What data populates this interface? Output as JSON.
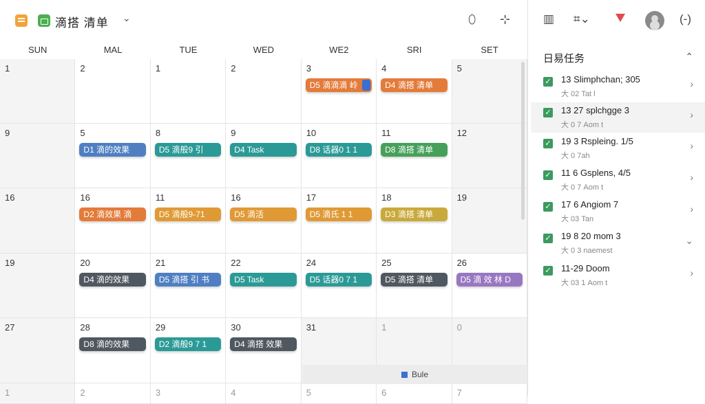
{
  "header": {
    "title": "滴搭 清单",
    "chevron_icon": "chevron-down-icon",
    "icons": [
      "shield-icon",
      "adjust-icon"
    ]
  },
  "weekdays": [
    "SUN",
    "MAL",
    "TUE",
    "WED",
    "WE2",
    "SRI",
    "SET"
  ],
  "colors": {
    "orange": "#e37b3a",
    "blue": "#4f7fc2",
    "teal": "#2b9a96",
    "green": "#46a05a",
    "amber": "#e09a35",
    "olive": "#c9a93b",
    "slate": "#4f5761",
    "purple": "#9877c2",
    "checkbox": "#3c9a5f",
    "accent_blue": "#3b6fd1"
  },
  "weeks": [
    [
      {
        "day": "1",
        "grey": true
      },
      {
        "day": "2"
      },
      {
        "day": "1"
      },
      {
        "day": "2"
      },
      {
        "day": "3",
        "event": {
          "label": "D5 滴滴滴 岭",
          "color": "orange"
        }
      },
      {
        "day": "4",
        "event": {
          "label": "D4 滴搭 清单",
          "color": "orange"
        }
      },
      {
        "day": "5",
        "grey": true
      }
    ],
    [
      {
        "day": "9",
        "grey": true
      },
      {
        "day": "5",
        "event": {
          "label": "D1 滴的效果",
          "color": "blue"
        }
      },
      {
        "day": "8",
        "event": {
          "label": "D5 滴般9 引",
          "color": "teal"
        }
      },
      {
        "day": "9",
        "event": {
          "label": "D4 Task",
          "color": "teal"
        }
      },
      {
        "day": "10",
        "event": {
          "label": "D8 话器0 1 1",
          "color": "teal"
        }
      },
      {
        "day": "11",
        "event": {
          "label": "D8 滴搭 清单",
          "color": "green"
        }
      },
      {
        "day": "12",
        "grey": true
      }
    ],
    [
      {
        "day": "16",
        "grey": true
      },
      {
        "day": "16",
        "event": {
          "label": "D2 滴效果 滴",
          "color": "orange"
        }
      },
      {
        "day": "11",
        "event": {
          "label": "D5 滴般9-71",
          "color": "amber"
        }
      },
      {
        "day": "16",
        "event": {
          "label": "D5 滴活",
          "color": "amber"
        }
      },
      {
        "day": "17",
        "event": {
          "label": "D5 滴氏 1 1",
          "color": "amber"
        }
      },
      {
        "day": "18",
        "event": {
          "label": "D3 滴搭 清单",
          "color": "olive"
        }
      },
      {
        "day": "19",
        "grey": true
      }
    ],
    [
      {
        "day": "19",
        "grey": true
      },
      {
        "day": "20",
        "event": {
          "label": "D4 滴的效果",
          "color": "slate"
        }
      },
      {
        "day": "21",
        "event": {
          "label": "D5 滴搭 引 书",
          "color": "blue"
        }
      },
      {
        "day": "22",
        "event": {
          "label": "D5 Task",
          "color": "teal"
        }
      },
      {
        "day": "24",
        "event": {
          "label": "D5 话器0 7 1",
          "color": "teal"
        }
      },
      {
        "day": "25",
        "event": {
          "label": "D5 滴搭 清单",
          "color": "slate"
        }
      },
      {
        "day": "26",
        "event": {
          "label": "D5 滴 效 林 D",
          "color": "purple"
        }
      }
    ],
    [
      {
        "day": "27",
        "grey": true
      },
      {
        "day": "28",
        "event": {
          "label": "D8 滴的效果",
          "color": "slate"
        }
      },
      {
        "day": "29",
        "event": {
          "label": "D2 滴般9 7 1",
          "color": "teal"
        }
      },
      {
        "day": "30",
        "event": {
          "label": "D4 滴搭 效果",
          "color": "slate"
        }
      },
      {
        "day": "31",
        "grey": true
      },
      {
        "day": "1",
        "grey": true,
        "muted": true
      },
      {
        "day": "0",
        "grey": true,
        "muted": true
      }
    ],
    [
      {
        "day": "1",
        "grey": true,
        "muted": true
      },
      {
        "day": "2",
        "muted": true
      },
      {
        "day": "3",
        "muted": true
      },
      {
        "day": "4",
        "muted": true
      },
      {
        "day": "5",
        "muted": true
      },
      {
        "day": "6",
        "muted": true
      },
      {
        "day": "7",
        "muted": true
      }
    ]
  ],
  "bottom_bar": {
    "label": "Bule"
  },
  "panel": {
    "icons": [
      "layout-icon",
      "grid-icon",
      "flag-icon",
      "avatar",
      "more-icon"
    ],
    "title": "日易任务",
    "tasks": [
      {
        "title": "13 Slimphchan; 305",
        "sub": "大 02 Tat l",
        "chev": "›"
      },
      {
        "title": "13 27 splchgge 3",
        "sub": "大 0 7 Aom t",
        "chev": "›",
        "selected": true
      },
      {
        "title": "19 3 Rspleing. 1/5",
        "sub": "大 0 7ah",
        "chev": "›"
      },
      {
        "title": "11 6 Gsplens, 4/5",
        "sub": "大 0 7 Aom t",
        "chev": "›"
      },
      {
        "title": "17 6 Angiom 7",
        "sub": "大 03 Tan",
        "chev": "›"
      },
      {
        "title": "19 8 20 mom 3",
        "sub": "大 0 3 naemest",
        "chev": "⌄"
      },
      {
        "title": "11-29 Doom",
        "sub": "大 03 1 Aom t",
        "chev": "›"
      }
    ]
  }
}
